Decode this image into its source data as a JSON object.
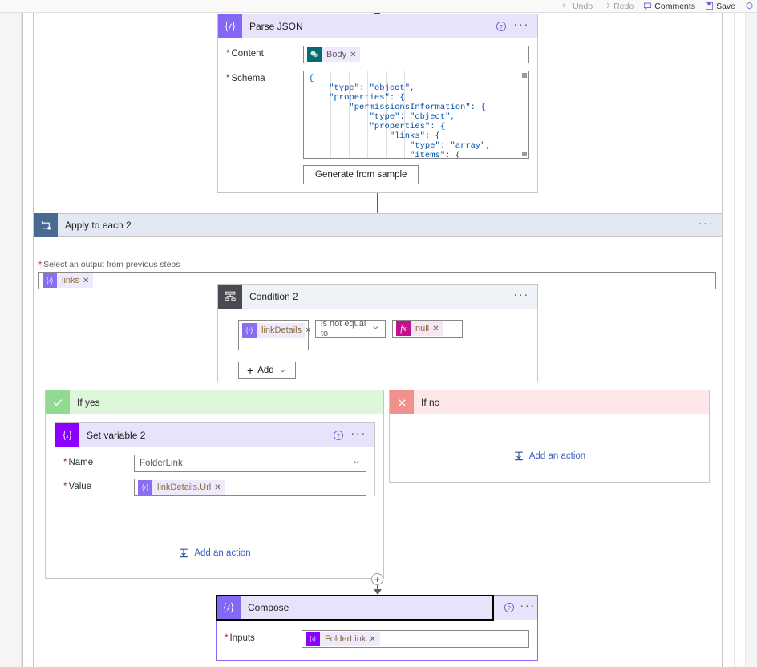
{
  "toolbar": {
    "items": [
      {
        "label": "Undo",
        "icon": "undo-icon",
        "state": "disabled"
      },
      {
        "label": "Redo",
        "icon": "redo-icon",
        "state": "disabled"
      },
      {
        "label": "Comments",
        "icon": "comment-icon",
        "state": "active"
      },
      {
        "label": "Save",
        "icon": "save-icon",
        "state": "active"
      }
    ]
  },
  "parse_json": {
    "title": "Parse JSON",
    "icon": "compose-braces-icon",
    "help_label": "?",
    "menu_label": "···",
    "content": {
      "label": "Content",
      "required": "*",
      "token": {
        "text": "Body",
        "icon": "sharepoint-icon",
        "remove": "✕"
      }
    },
    "schema": {
      "label": "Schema",
      "required": "*",
      "value": "{\n    \"type\": \"object\",\n    \"properties\": {\n        \"permissionsInformation\": {\n            \"type\": \"object\",\n            \"properties\": {\n                \"links\": {\n                    \"type\": \"array\",\n                    \"items\": {\n                        \"type\": \"object\","
    },
    "generate_button": "Generate from sample"
  },
  "apply_to_each": {
    "title": "Apply to each 2",
    "icon": "loop-icon",
    "menu_label": "···",
    "output_field": {
      "label": "Select an output from previous steps",
      "required": "*",
      "token": {
        "text": "links",
        "icon": "expression-icon",
        "remove": "✕"
      }
    }
  },
  "condition": {
    "title": "Condition 2",
    "icon": "condition-branch-icon",
    "menu_label": "···",
    "left_operand": {
      "text": "linkDetails",
      "icon": "expression-icon",
      "remove": "✕"
    },
    "operator": {
      "value": "is not equal to",
      "caret": "⌄"
    },
    "right_operand": {
      "text": "null",
      "icon": "function-fx-icon",
      "remove": "✕"
    },
    "add_button": {
      "label": "Add",
      "plus": "+",
      "caret": "⌄"
    }
  },
  "if_yes": {
    "label": "If yes",
    "icon": "checkmark-icon",
    "add_action": {
      "label": "Add an action",
      "icon": "insert-step-icon"
    },
    "set_variable": {
      "title": "Set variable 2",
      "icon": "variable-braces-icon",
      "help_label": "?",
      "menu_label": "···",
      "name": {
        "label": "Name",
        "required": "*",
        "value": "FolderLink",
        "caret": "⌄"
      },
      "value": {
        "label": "Value",
        "required": "*",
        "token": {
          "text": "linkDetails.Url",
          "icon": "expression-icon",
          "remove": "✕"
        }
      }
    }
  },
  "if_no": {
    "label": "If no",
    "icon": "close-x-icon",
    "add_action": {
      "label": "Add an action",
      "icon": "insert-step-icon"
    }
  },
  "compose": {
    "title": "Compose",
    "icon": "compose-braces-icon",
    "help_label": "?",
    "menu_label": "···",
    "selected": true,
    "inputs": {
      "label": "Inputs",
      "required": "*",
      "token": {
        "text": "FolderLink",
        "icon": "variable-braces-icon",
        "remove": "✕"
      }
    },
    "insert_node": "+"
  },
  "colors": {
    "accent_purple": "#8567f5",
    "variable_violet": "#8c00ff",
    "slate": "#486991",
    "dark_slate": "#4a4a52",
    "yes_green": "#92d991",
    "no_red": "#f1918e",
    "link_blue": "#3b5ec4",
    "token_bg": "#efe9fc"
  }
}
